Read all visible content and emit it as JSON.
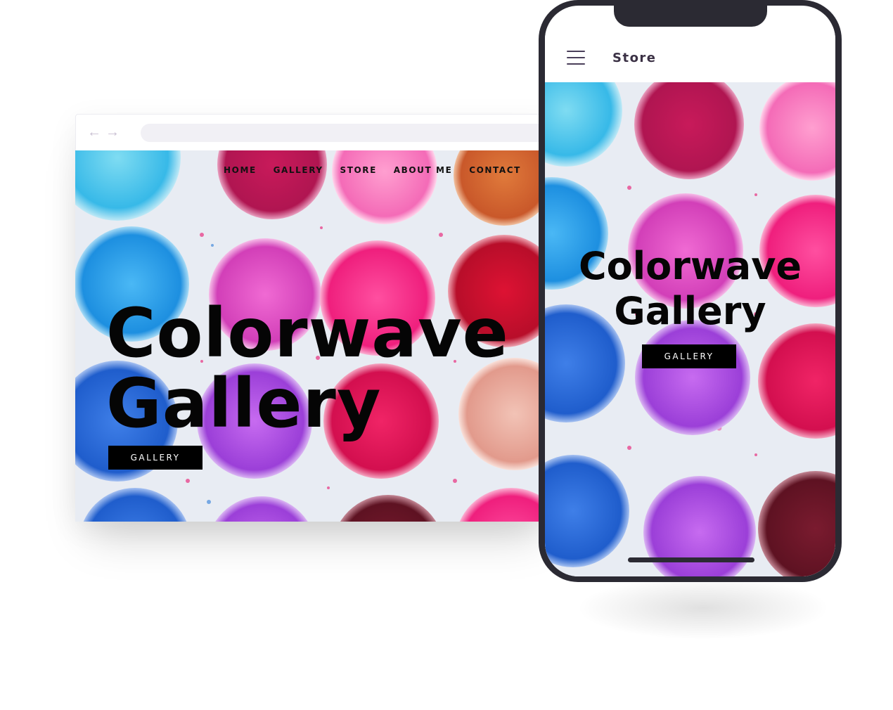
{
  "desktop": {
    "nav": {
      "home": "HOME",
      "gallery": "GALLERY",
      "store": "STORE",
      "about": "ABOUT ME",
      "contact": "CONTACT"
    },
    "title_line1": "Colorwave",
    "title_line2": "Gallery",
    "cta_label": "GALLERY"
  },
  "phone": {
    "header_label": "Store",
    "title_line1": "Colorwave",
    "title_line2": "Gallery",
    "cta_label": "GALLERY"
  },
  "icons": {
    "back": "arrow-left-icon",
    "forward": "arrow-right-icon",
    "menu": "hamburger-menu-icon"
  },
  "colors": {
    "cta_background": "#000000",
    "cta_text": "#ffffff",
    "phone_frame": "#2b2a33",
    "nav_arrows": "#c8bfd2"
  }
}
